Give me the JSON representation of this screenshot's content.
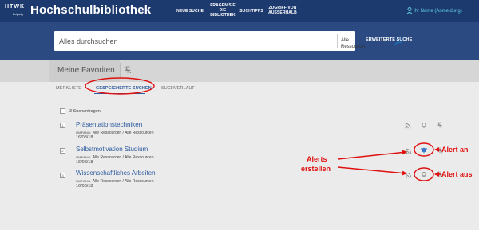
{
  "header": {
    "logo": {
      "brand": "HTWK",
      "city": "Leipzig"
    },
    "title": "Hochschulbibliothek",
    "nav": [
      {
        "label": "NEUE SUCHE"
      },
      {
        "label": "FRAGEN SIE DIE BIBLIOTHEK"
      },
      {
        "label": "SUCHTIPPS"
      },
      {
        "label": "ZUGRIFF VON AUSSERHALB"
      }
    ],
    "user_label": "Ihr Name (Anmeldung)"
  },
  "search": {
    "placeholder": "Alles durchsuchen",
    "scope": "Alle Ressourcen",
    "advanced_label": "ERWEITERTE SUCHE"
  },
  "favorites": {
    "title": "Meine Favoriten",
    "tabs": [
      {
        "label": "MERKLISTE",
        "active": false
      },
      {
        "label": "GESPEICHERTE SUCHEN",
        "active": true
      },
      {
        "label": "SUCHVERLAUF",
        "active": false
      }
    ],
    "count_label": "3 Suchanfragen",
    "items": [
      {
        "num": "1",
        "title": "Präsentationstechniken",
        "meta_key": "UMFANG:",
        "meta_scope": "Alle Ressourcen",
        "meta_sep": "/",
        "meta_scope2": "Alle Ressourcen",
        "date": "16/08/18",
        "alert_on": false
      },
      {
        "num": "2",
        "title": "Selbstmotivation Studium",
        "meta_key": "UMFANG:",
        "meta_scope": "Alle Ressourcen",
        "meta_sep": "/",
        "meta_scope2": "Alle Ressourcen",
        "date": "16/08/18",
        "alert_on": true
      },
      {
        "num": "3",
        "title": "Wissenschaftliches Arbeiten",
        "meta_key": "UMFANG:",
        "meta_scope": "Alle Ressourcen",
        "meta_sep": "/",
        "meta_scope2": "Alle Ressourcen",
        "date": "16/08/18",
        "alert_on": false
      }
    ]
  },
  "annotations": {
    "alerts_line1": "Alerts",
    "alerts_line2": "erstellen",
    "alert_on": "Alert an",
    "alert_off": "Alert aus"
  },
  "colors": {
    "topbar": "#1d3a6f",
    "searchband": "#2c4a82",
    "link": "#2d5a9e",
    "annotation": "#e01010",
    "user_link": "#5fd0e0"
  }
}
